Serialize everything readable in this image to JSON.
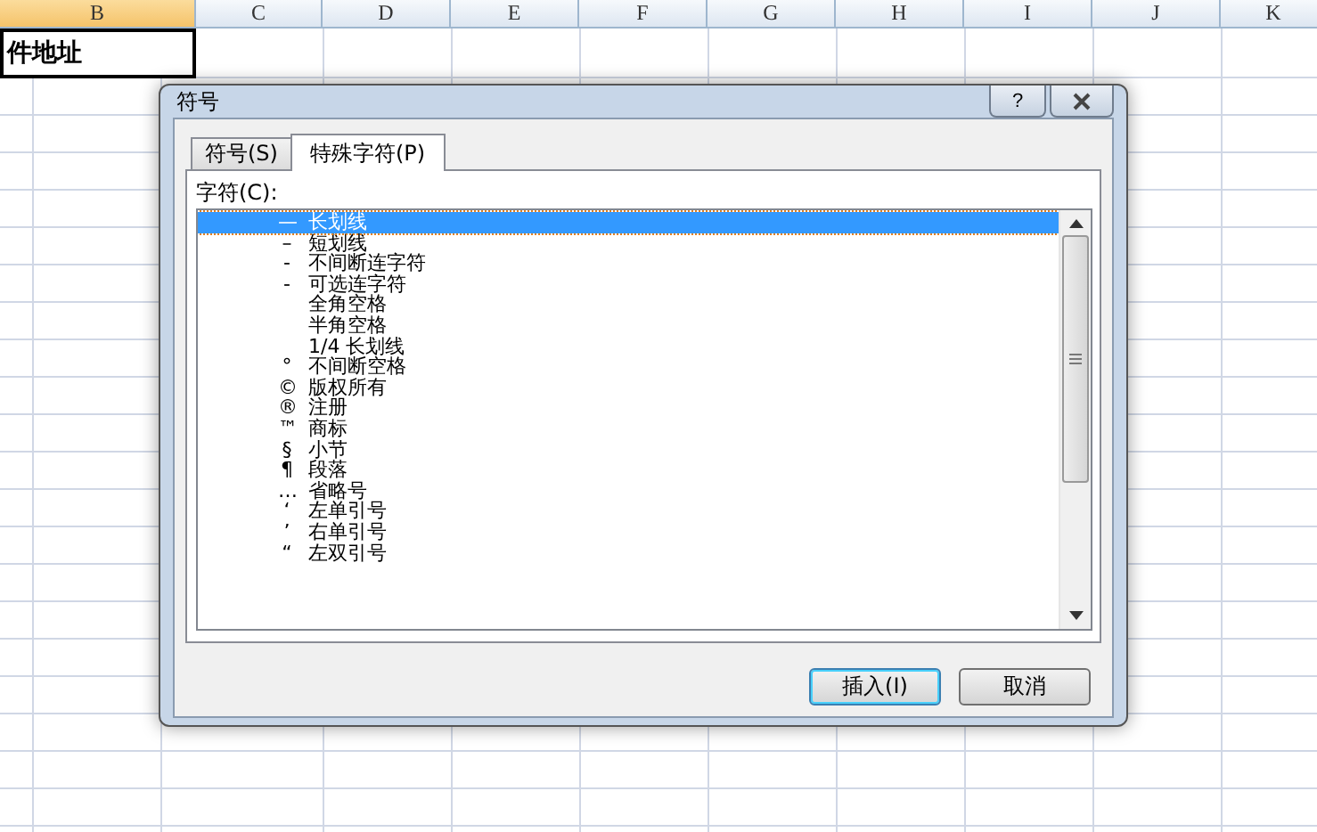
{
  "sheet": {
    "columns": [
      {
        "label": "B",
        "selected": true
      },
      {
        "label": "C",
        "selected": false
      },
      {
        "label": "D",
        "selected": false
      },
      {
        "label": "E",
        "selected": false
      },
      {
        "label": "F",
        "selected": false
      },
      {
        "label": "G",
        "selected": false
      },
      {
        "label": "H",
        "selected": false
      },
      {
        "label": "I",
        "selected": false
      },
      {
        "label": "J",
        "selected": false
      },
      {
        "label": "K",
        "selected": false
      }
    ],
    "active_cell": "件地址"
  },
  "dialog": {
    "title": "符号",
    "help": "?",
    "tabs": [
      {
        "label": "符号(S)",
        "selected": false
      },
      {
        "label": "特殊字符(P)",
        "selected": true
      }
    ],
    "list_label": "字符(C):",
    "rows": [
      {
        "symbol": "—",
        "name": "长划线",
        "selected": true
      },
      {
        "symbol": "–",
        "name": "短划线",
        "selected": false
      },
      {
        "symbol": "-",
        "name": "不间断连字符",
        "selected": false
      },
      {
        "symbol": "-",
        "name": "可选连字符",
        "selected": false
      },
      {
        "name": "全角空格",
        "selected": false
      },
      {
        "name": "半角空格",
        "selected": false
      },
      {
        "name": "1/4 长划线",
        "selected": false
      },
      {
        "symbol": "°",
        "name": "不间断空格",
        "selected": false
      },
      {
        "symbol": "©",
        "name": "版权所有",
        "selected": false
      },
      {
        "symbol": "®",
        "name": "注册",
        "selected": false
      },
      {
        "symbol": "™",
        "name": "商标",
        "selected": false
      },
      {
        "symbol": "§",
        "name": "小节",
        "selected": false
      },
      {
        "symbol": "¶",
        "name": "段落",
        "selected": false
      },
      {
        "symbol": "…",
        "name": "省略号",
        "selected": false
      },
      {
        "symbol": "‘",
        "name": "左单引号",
        "selected": false
      },
      {
        "symbol": "’",
        "name": "右单引号",
        "selected": false
      },
      {
        "symbol": "“",
        "name": "左双引号",
        "selected": false
      }
    ],
    "buttons": [
      {
        "label": "插入(I)",
        "kind": "default"
      },
      {
        "label": "取消",
        "kind": "normal"
      }
    ]
  }
}
